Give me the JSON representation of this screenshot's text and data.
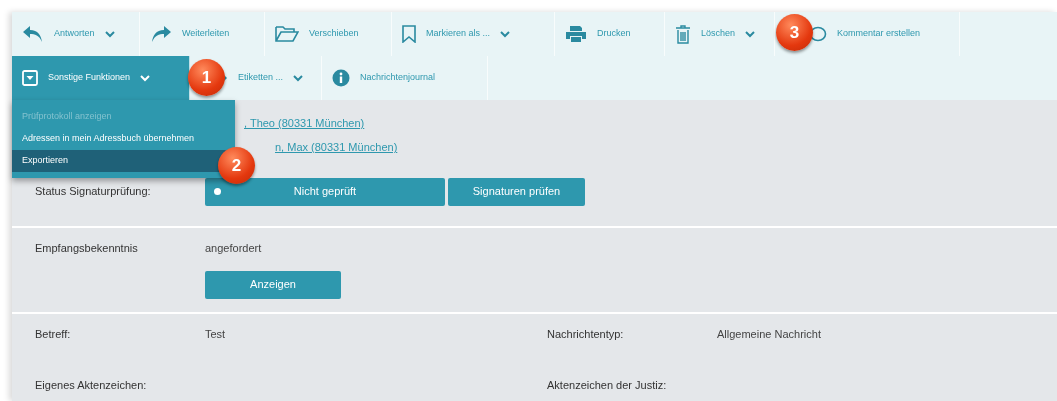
{
  "toolbar_row_1": [
    {
      "label": "Antworten",
      "dropdown": true
    },
    {
      "label": "Weiterleiten",
      "dropdown": false
    },
    {
      "label": "Verschieben",
      "dropdown": false
    },
    {
      "label": "Markieren als ...",
      "dropdown": true
    },
    {
      "label": "Drucken",
      "dropdown": false
    },
    {
      "label": "Löschen",
      "dropdown": true
    },
    {
      "label": "Kommentar erstellen",
      "dropdown": false
    }
  ],
  "toolbar_row_2": [
    {
      "label": "Sonstige Funktionen",
      "dropdown": true,
      "selected": true
    },
    {
      "label": "Etiketten ...",
      "dropdown": true,
      "selected": false
    },
    {
      "label": "Nachrichtenjournal",
      "dropdown": false,
      "selected": false
    }
  ],
  "menu": [
    {
      "label": "Prüfprotokoll anzeigen",
      "disabled": true,
      "selected": false
    },
    {
      "label": "Adressen in mein Adressbuch übernehmen",
      "disabled": false,
      "selected": false
    },
    {
      "label": "Exportieren",
      "disabled": false,
      "selected": true
    }
  ],
  "recipients": [
    ", Theo (80331 München)",
    "n, Max (80331 München)"
  ],
  "signature": {
    "label": "Status Signaturprüfung:",
    "status": "Nicht geprüft",
    "button": "Signaturen prüfen"
  },
  "receipt": {
    "label": "Empfangsbekenntnis",
    "value": "angefordert",
    "button": "Anzeigen"
  },
  "fields": [
    {
      "label": "Betreff:",
      "value": "Test"
    },
    {
      "label": "Nachrichtentyp:",
      "value": "Allgemeine Nachricht"
    },
    {
      "label": "Eigenes Aktenzeichen:"
    },
    {
      "label": "Aktenzeichen der Justiz:"
    }
  ],
  "callouts": [
    "1",
    "2",
    "3"
  ]
}
